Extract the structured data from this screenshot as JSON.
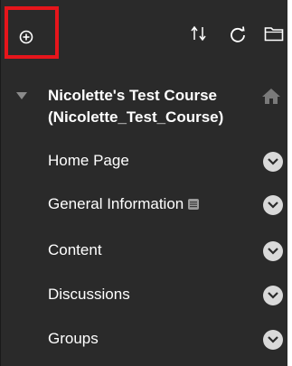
{
  "toolbar": {
    "add_icon": "plus-circle-icon",
    "reorder_icon": "reorder-arrows-icon",
    "refresh_icon": "refresh-icon",
    "folder_icon": "folder-icon",
    "highlight_color": "#e6151b"
  },
  "course": {
    "title": "Nicolette's Test Course (Nicolette_Test_Course)",
    "expand_icon": "triangle-down-icon",
    "home_icon": "home-icon"
  },
  "nav": {
    "items": [
      {
        "label": "Home Page"
      },
      {
        "label": "General Information",
        "badge_icon": "info-badge-icon"
      },
      {
        "label": "Content"
      },
      {
        "label": "Discussions"
      },
      {
        "label": "Groups"
      }
    ]
  },
  "colors": {
    "panel_bg": "#2a2a2a",
    "text": "#ffffff",
    "chevron_bg": "#d9d9d9"
  }
}
